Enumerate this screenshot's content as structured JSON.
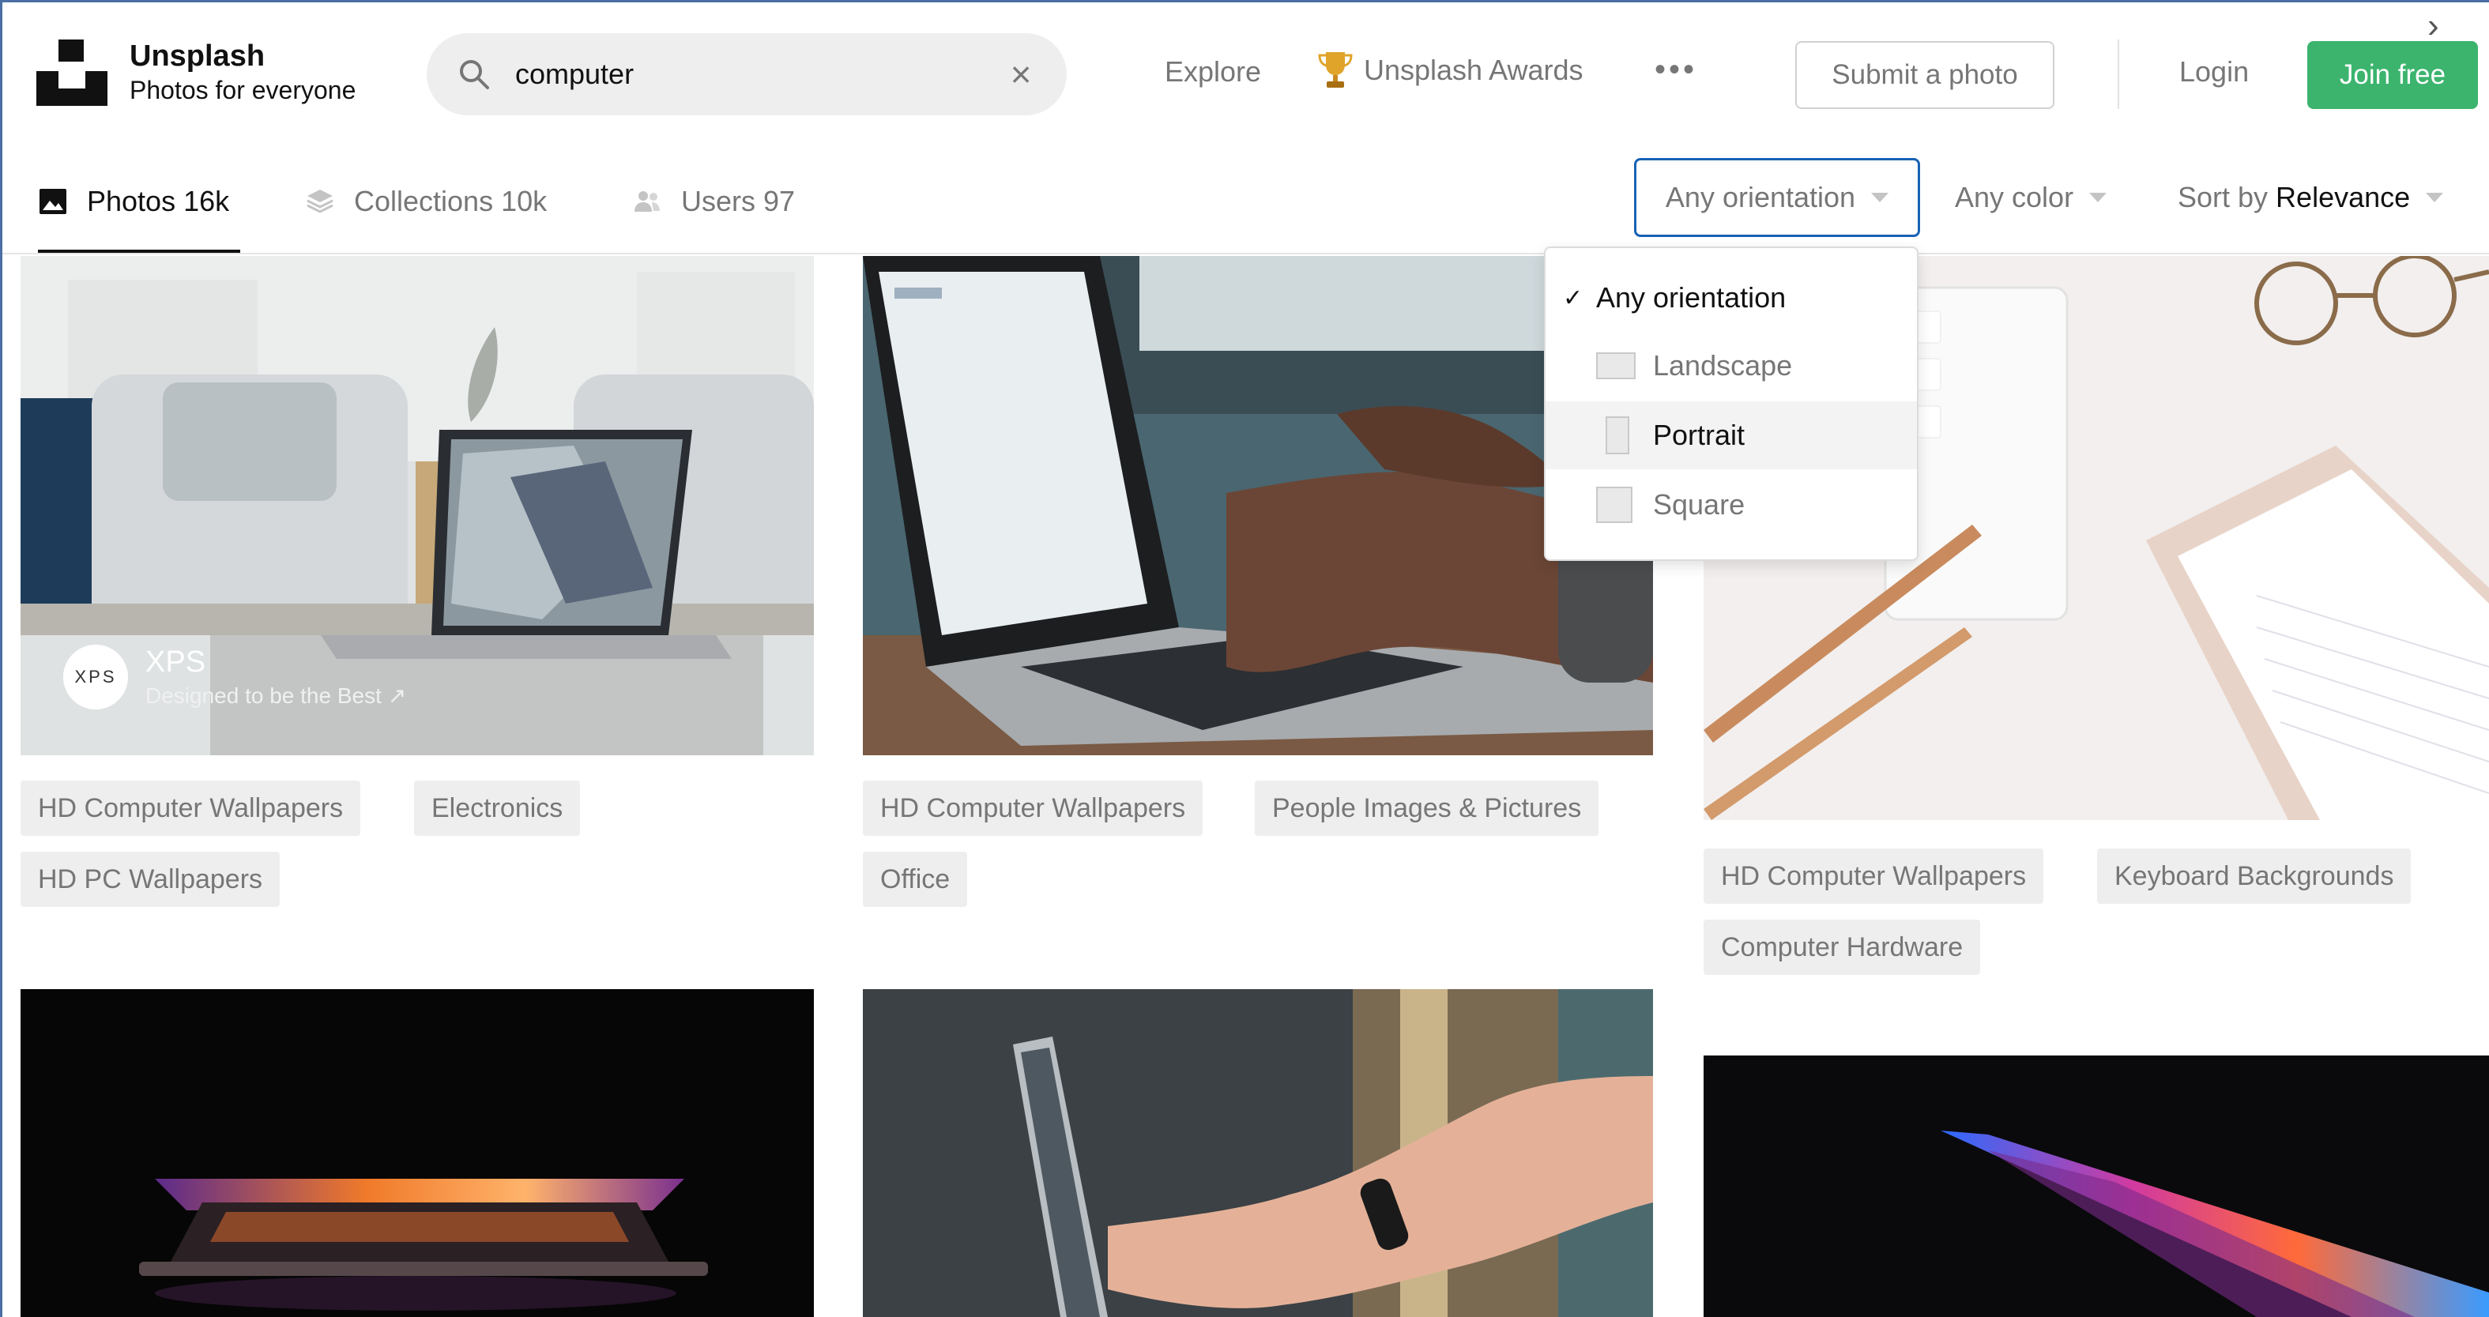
{
  "header": {
    "brand": {
      "name": "Unsplash",
      "tagline": "Photos for everyone"
    },
    "search": {
      "value": "computer",
      "clear_icon": "close-icon"
    },
    "nav": {
      "explore": "Explore",
      "awards": "Unsplash Awards",
      "more": "•••",
      "submit": "Submit a photo",
      "login": "Login",
      "join": "Join free"
    },
    "colors": {
      "join_bg": "#3cb46e",
      "focus_border": "#1862b5"
    }
  },
  "subnav": {
    "tabs": [
      {
        "label": "Photos 16k",
        "icon": "photo-icon",
        "active": true
      },
      {
        "label": "Collections 10k",
        "icon": "collections-icon",
        "active": false
      },
      {
        "label": "Users 97",
        "icon": "users-icon",
        "active": false
      }
    ],
    "filters": {
      "orientation": "Any orientation",
      "color": "Any color",
      "sort_prefix": "Sort by",
      "sort_value": "Relevance"
    }
  },
  "orientation_menu": {
    "items": [
      {
        "label": "Any orientation",
        "selected": true
      },
      {
        "label": "Landscape",
        "icon": "landscape-shape-icon"
      },
      {
        "label": "Portrait",
        "icon": "portrait-shape-icon"
      },
      {
        "label": "Square",
        "icon": "square-shape-icon"
      }
    ]
  },
  "photos": {
    "col1": {
      "sponsor": {
        "name": "XPS",
        "subtitle": "Designed to be the Best ↗",
        "logo_text": "XPS"
      },
      "tags": [
        "HD Computer Wallpapers",
        "Electronics",
        "HD PC Wallpapers"
      ]
    },
    "col2": {
      "tags": [
        "HD Computer Wallpapers",
        "People Images & Pictures",
        "Office"
      ]
    },
    "col3": {
      "tags": [
        "HD Computer Wallpapers",
        "Keyboard Backgrounds",
        "Computer Hardware"
      ]
    }
  }
}
